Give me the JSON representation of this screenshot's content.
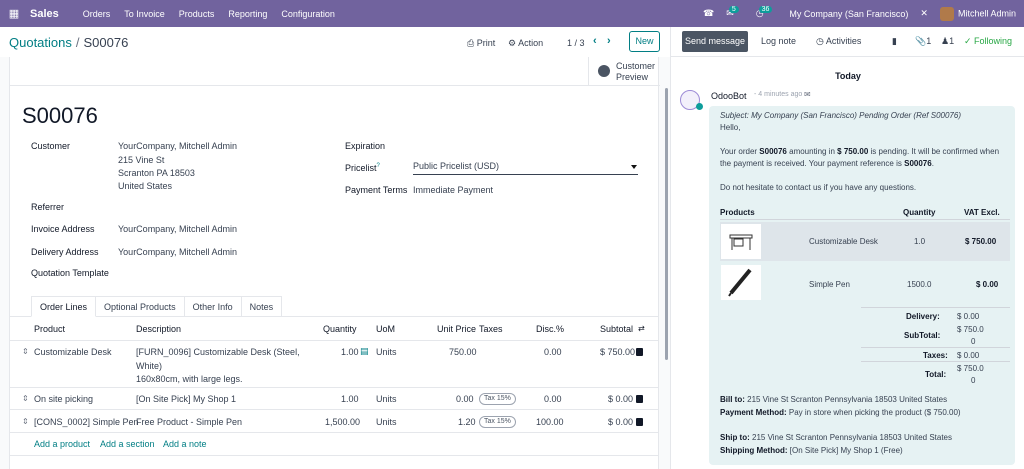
{
  "topbar": {
    "app_name": "Sales",
    "menu": [
      "Orders",
      "To Invoice",
      "Products",
      "Reporting",
      "Configuration"
    ],
    "messages_count": "5",
    "activities_count": "36",
    "company": "My Company (San Francisco)",
    "user": "Mitchell Admin"
  },
  "control": {
    "breadcrumb_parent": "Quotations",
    "breadcrumb_sep": "/",
    "breadcrumb_current": "S00076",
    "print": "Print",
    "action": "Action",
    "pager": "1 / 3",
    "new": "New"
  },
  "form": {
    "preview_line1": "Customer",
    "preview_line2": "Preview",
    "name": "S00076",
    "customer_label": "Customer",
    "customer_lines": [
      "YourCompany, Mitchell Admin",
      "215 Vine St",
      "Scranton PA 18503",
      "United States"
    ],
    "referrer_label": "Referrer",
    "invoice_label": "Invoice Address",
    "invoice_value": "YourCompany, Mitchell Admin",
    "delivery_label": "Delivery Address",
    "delivery_value": "YourCompany, Mitchell Admin",
    "template_label": "Quotation Template",
    "expiration_label": "Expiration",
    "pricelist_label": "Pricelist",
    "pricelist_help": "?",
    "pricelist_value": "Public Pricelist (USD)",
    "terms_label": "Payment Terms",
    "terms_value": "Immediate Payment"
  },
  "tabs": [
    "Order Lines",
    "Optional Products",
    "Other Info",
    "Notes"
  ],
  "lines": {
    "headers": {
      "product": "Product",
      "description": "Description",
      "quantity": "Quantity",
      "uom": "UoM",
      "unit_price": "Unit Price",
      "taxes": "Taxes",
      "disc": "Disc.%",
      "subtotal": "Subtotal"
    },
    "rows": [
      {
        "product": "Customizable Desk",
        "desc1": "[FURN_0096] Customizable Desk (Steel,",
        "desc2": "White)",
        "desc3": "160x80cm, with large legs.",
        "qty": "1.00",
        "uom": "Units",
        "price": "750.00",
        "tax": "",
        "disc": "0.00",
        "subtotal": "$ 750.00"
      },
      {
        "product": "On site picking",
        "desc1": "[On Site Pick] My Shop 1",
        "qty": "1.00",
        "uom": "Units",
        "price": "0.00",
        "tax": "Tax 15%",
        "disc": "0.00",
        "subtotal": "$ 0.00"
      },
      {
        "product": "[CONS_0002] Simple Pen",
        "desc1": "Free Product - Simple Pen",
        "qty": "1,500.00",
        "uom": "Units",
        "price": "1.20",
        "tax": "Tax 15%",
        "disc": "100.00",
        "subtotal": "$ 0.00"
      }
    ],
    "add_product": "Add a product",
    "add_section": "Add a section",
    "add_note": "Add a note"
  },
  "chatter": {
    "send": "Send message",
    "log": "Log note",
    "activities": "Activities",
    "attachments": "1",
    "followers": "1",
    "following": "Following",
    "today": "Today",
    "author": "OdooBot",
    "time": "- 4 minutes ago",
    "subject": "Subject: My Company (San Francisco) Pending Order (Ref S00076)",
    "hello": "Hello,",
    "body1_a": "Your order ",
    "body1_b": "S00076",
    "body1_c": " amounting in ",
    "body1_d": "$ 750.00",
    "body1_e": " is pending. It will be confirmed when",
    "body2_a": "the payment is received. Your payment reference is ",
    "body2_b": "S00076",
    "body2_c": ".",
    "body3": "Do not hesitate to contact us if you have any questions.",
    "products_header": {
      "products": "Products",
      "quantity": "Quantity",
      "vat": "VAT Excl."
    },
    "products": [
      {
        "name": "Customizable Desk",
        "qty": "1.0",
        "price": "$ 750.00"
      },
      {
        "name": "Simple Pen",
        "qty": "1500.0",
        "price": "$ 0.00"
      }
    ],
    "totals": {
      "delivery_label": "Delivery:",
      "delivery": "$ 0.00",
      "subtotal_label": "SubTotal:",
      "subtotal_1": "$ 750.0",
      "subtotal_2": "0",
      "taxes_label": "Taxes:",
      "taxes": "$ 0.00",
      "total_label": "Total:",
      "total_1": "$ 750.0",
      "total_2": "0"
    },
    "bill_label": "Bill to:",
    "bill": " 215 Vine St Scranton Pennsylvania 18503 United States",
    "payment_label": "Payment Method:",
    "payment": " Pay in store when picking the product ($ 750.00)",
    "ship_label": "Ship to:",
    "ship": " 215 Vine St Scranton Pennsylvania 18503 United States",
    "shipping_label": "Shipping Method:",
    "shipping": " [On Site Pick] My Shop 1 (Free)"
  }
}
